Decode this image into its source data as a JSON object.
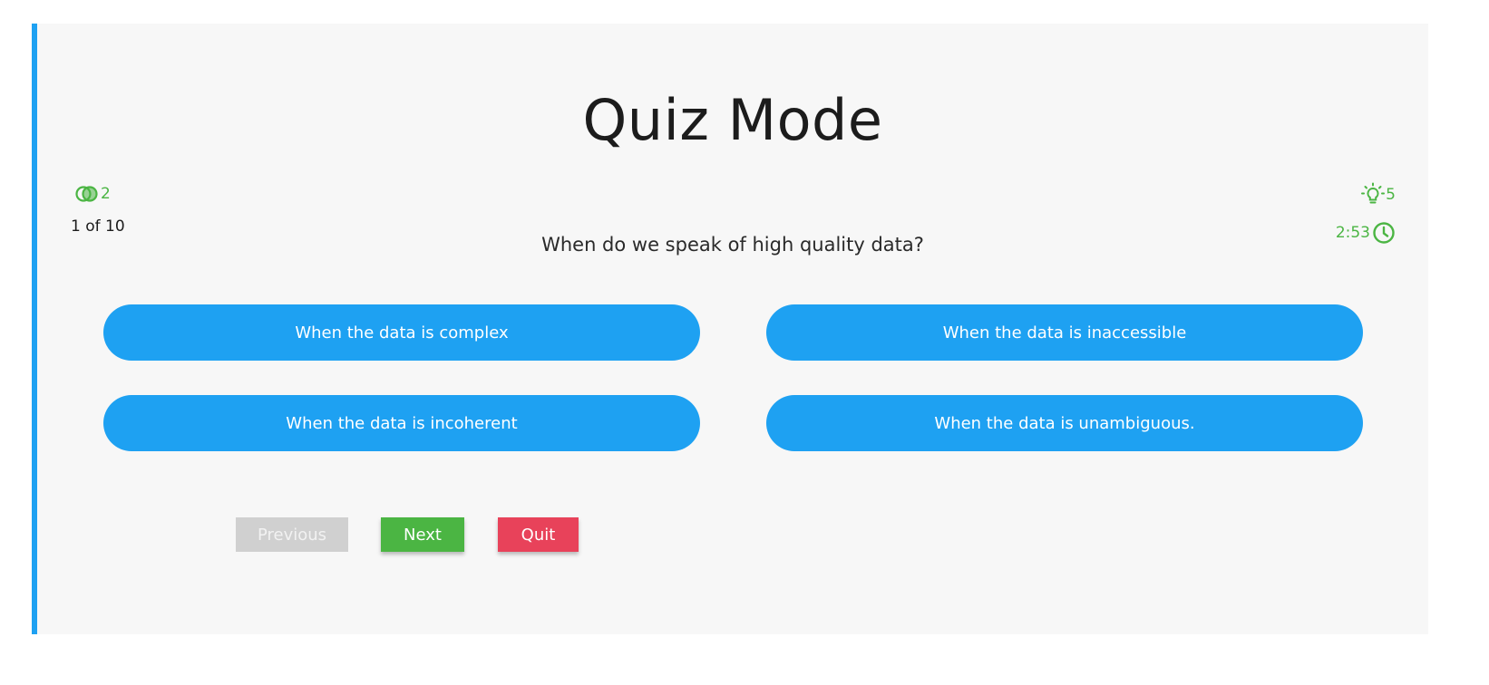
{
  "title": "Quiz Mode",
  "lifelines": {
    "fifty_fifty_icon": "fifty-fifty-icon",
    "fifty_fifty_count": "2",
    "hints_icon": "lightbulb-icon",
    "hints_count": "5"
  },
  "progress": {
    "counter": "1 of 10"
  },
  "timer": {
    "value": "2:53",
    "icon": "clock-icon"
  },
  "question": "When do we speak of high quality data?",
  "options": [
    "When the data is complex",
    "When the data is inaccessible",
    "When the data is incoherent",
    "When the data is unambiguous."
  ],
  "buttons": {
    "previous": "Previous",
    "next": "Next",
    "quit": "Quit"
  },
  "colors": {
    "accent": "#1ea1f2",
    "success": "#4bb543",
    "danger": "#e8425a",
    "disabled": "#d0d0d0"
  }
}
